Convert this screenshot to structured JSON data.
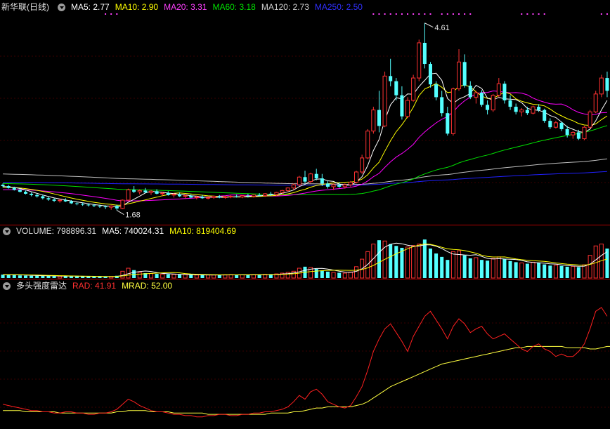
{
  "header": {
    "title": "新华联(日线)",
    "ma5": "MA5: 2.77",
    "ma10": "MA10: 2.90",
    "ma20": "MA20: 3.31",
    "ma60": "MA60: 3.18",
    "ma120": "MA120: 2.73",
    "ma250": "MA250: 2.50"
  },
  "volume_header": {
    "volume": "VOLUME: 798896.31",
    "ma5": "MA5: 740024.31",
    "ma10": "MA10: 819404.69"
  },
  "indicator_header": {
    "name": "多头强度雷达",
    "rad": "RAD: 41.91",
    "mrad": "MRAD: 52.00"
  },
  "annotations": {
    "high": "4.61",
    "low": "1.68"
  },
  "colors": {
    "up": "#ff3232",
    "down": "#54ffff",
    "ma5": "#ffffff",
    "ma10": "#ffff00",
    "ma20": "#ff00ff",
    "ma60": "#00e000",
    "ma120": "#c0c0c0",
    "ma250": "#2020ff",
    "rad": "#ff2020",
    "mrad": "#ffff40"
  },
  "chart_data": [
    {
      "type": "candlestick",
      "title": "新华联(日线)",
      "ylim": [
        1.5,
        4.75
      ],
      "ohlc": [
        [
          2.08,
          2.1,
          2.04,
          2.06
        ],
        [
          2.06,
          2.08,
          2.02,
          2.03
        ],
        [
          2.03,
          2.05,
          1.99,
          2.0
        ],
        [
          2.0,
          2.02,
          1.96,
          1.97
        ],
        [
          1.97,
          1.99,
          1.93,
          1.94
        ],
        [
          1.94,
          1.96,
          1.9,
          1.92
        ],
        [
          1.92,
          1.94,
          1.88,
          1.9
        ],
        [
          1.9,
          1.92,
          1.85,
          1.87
        ],
        [
          1.87,
          1.89,
          1.83,
          1.85
        ],
        [
          1.85,
          1.87,
          1.81,
          1.83
        ],
        [
          1.83,
          1.86,
          1.8,
          1.84
        ],
        [
          1.84,
          1.87,
          1.81,
          1.82
        ],
        [
          1.82,
          1.84,
          1.78,
          1.79
        ],
        [
          1.79,
          1.81,
          1.76,
          1.78
        ],
        [
          1.78,
          1.8,
          1.75,
          1.77
        ],
        [
          1.77,
          1.79,
          1.74,
          1.76
        ],
        [
          1.76,
          1.78,
          1.73,
          1.75
        ],
        [
          1.75,
          1.77,
          1.72,
          1.74
        ],
        [
          1.74,
          1.76,
          1.7,
          1.73
        ],
        [
          1.73,
          1.76,
          1.69,
          1.75
        ],
        [
          1.75,
          1.77,
          1.68,
          1.71
        ],
        [
          1.71,
          1.85,
          1.7,
          1.84
        ],
        [
          1.84,
          2.02,
          1.83,
          2.0
        ],
        [
          2.0,
          2.06,
          1.95,
          1.97
        ],
        [
          1.97,
          2.01,
          1.93,
          1.99
        ],
        [
          1.99,
          2.03,
          1.95,
          1.96
        ],
        [
          1.96,
          2.0,
          1.92,
          1.98
        ],
        [
          1.98,
          2.01,
          1.93,
          1.94
        ],
        [
          1.94,
          1.97,
          1.9,
          1.95
        ],
        [
          1.95,
          1.98,
          1.91,
          1.92
        ],
        [
          1.92,
          1.95,
          1.88,
          1.93
        ],
        [
          1.93,
          1.96,
          1.89,
          1.9
        ],
        [
          1.9,
          1.93,
          1.86,
          1.91
        ],
        [
          1.91,
          1.93,
          1.87,
          1.88
        ],
        [
          1.88,
          1.91,
          1.85,
          1.89
        ],
        [
          1.89,
          1.92,
          1.86,
          1.87
        ],
        [
          1.87,
          1.9,
          1.85,
          1.88
        ],
        [
          1.88,
          1.91,
          1.86,
          1.9
        ],
        [
          1.9,
          1.92,
          1.87,
          1.88
        ],
        [
          1.88,
          1.91,
          1.86,
          1.89
        ],
        [
          1.89,
          1.92,
          1.87,
          1.9
        ],
        [
          1.9,
          1.93,
          1.88,
          1.89
        ],
        [
          1.89,
          1.92,
          1.87,
          1.91
        ],
        [
          1.91,
          1.94,
          1.88,
          1.9
        ],
        [
          1.9,
          1.93,
          1.88,
          1.92
        ],
        [
          1.92,
          1.95,
          1.9,
          1.91
        ],
        [
          1.91,
          1.95,
          1.89,
          1.94
        ],
        [
          1.94,
          1.97,
          1.91,
          1.93
        ],
        [
          1.93,
          1.97,
          1.91,
          1.96
        ],
        [
          1.96,
          2.0,
          1.94,
          1.99
        ],
        [
          1.99,
          2.04,
          1.97,
          2.03
        ],
        [
          2.03,
          2.1,
          2.0,
          2.08
        ],
        [
          2.08,
          2.22,
          2.06,
          2.2
        ],
        [
          2.2,
          2.3,
          2.1,
          2.13
        ],
        [
          2.13,
          2.27,
          2.1,
          2.25
        ],
        [
          2.25,
          2.33,
          2.15,
          2.18
        ],
        [
          2.18,
          2.25,
          2.06,
          2.1
        ],
        [
          2.1,
          2.14,
          2.02,
          2.05
        ],
        [
          2.05,
          2.1,
          2.0,
          2.08
        ],
        [
          2.08,
          2.12,
          2.03,
          2.05
        ],
        [
          2.05,
          2.1,
          2.02,
          2.08
        ],
        [
          2.08,
          2.14,
          2.05,
          2.12
        ],
        [
          2.12,
          2.3,
          2.1,
          2.28
        ],
        [
          2.28,
          2.55,
          2.25,
          2.5
        ],
        [
          2.5,
          2.95,
          2.48,
          2.92
        ],
        [
          2.92,
          3.3,
          2.88,
          3.25
        ],
        [
          3.25,
          3.55,
          2.9,
          3.0
        ],
        [
          3.0,
          3.85,
          2.98,
          3.78
        ],
        [
          3.78,
          4.05,
          3.62,
          3.7
        ],
        [
          3.7,
          3.75,
          3.4,
          3.48
        ],
        [
          3.48,
          3.62,
          3.1,
          3.15
        ],
        [
          3.15,
          3.45,
          3.12,
          3.4
        ],
        [
          3.4,
          3.8,
          3.38,
          3.75
        ],
        [
          3.75,
          4.35,
          3.7,
          4.3
        ],
        [
          4.3,
          4.61,
          3.9,
          3.97
        ],
        [
          3.97,
          4.0,
          3.6,
          3.65
        ],
        [
          3.65,
          3.7,
          3.4,
          3.45
        ],
        [
          3.45,
          3.55,
          3.15,
          3.2
        ],
        [
          3.2,
          3.3,
          2.85,
          2.88
        ],
        [
          2.88,
          3.6,
          2.85,
          3.58
        ],
        [
          3.58,
          4.2,
          3.55,
          4.0
        ],
        [
          4.0,
          4.12,
          3.6,
          3.63
        ],
        [
          3.63,
          3.7,
          3.42,
          3.45
        ],
        [
          3.45,
          3.55,
          3.35,
          3.52
        ],
        [
          3.52,
          3.56,
          3.3,
          3.33
        ],
        [
          3.33,
          3.4,
          3.18,
          3.25
        ],
        [
          3.25,
          3.5,
          3.22,
          3.48
        ],
        [
          3.48,
          3.75,
          3.45,
          3.66
        ],
        [
          3.66,
          3.7,
          3.35,
          3.4
        ],
        [
          3.4,
          3.48,
          3.25,
          3.3
        ],
        [
          3.3,
          3.35,
          3.18,
          3.22
        ],
        [
          3.22,
          3.28,
          3.15,
          3.25
        ],
        [
          3.25,
          3.3,
          3.17,
          3.2
        ],
        [
          3.2,
          3.32,
          3.18,
          3.3
        ],
        [
          3.3,
          3.34,
          3.22,
          3.25
        ],
        [
          3.25,
          3.27,
          3.05,
          3.08
        ],
        [
          3.08,
          3.12,
          2.95,
          2.98
        ],
        [
          2.98,
          3.08,
          2.96,
          3.05
        ],
        [
          3.05,
          3.07,
          2.92,
          2.95
        ],
        [
          2.95,
          3.0,
          2.82,
          2.86
        ],
        [
          2.86,
          2.92,
          2.8,
          2.9
        ],
        [
          2.9,
          2.94,
          2.78,
          2.8
        ],
        [
          2.8,
          3.0,
          2.78,
          2.98
        ],
        [
          2.98,
          3.25,
          2.96,
          3.22
        ],
        [
          3.22,
          3.55,
          3.2,
          3.5
        ],
        [
          3.5,
          3.8,
          3.45,
          3.75
        ],
        [
          3.75,
          3.85,
          3.45,
          3.55
        ]
      ],
      "ma_periods": [
        5,
        10,
        20,
        60,
        120,
        250
      ],
      "ma_values_last": [
        2.77,
        2.9,
        3.31,
        3.18,
        2.73,
        2.5
      ],
      "annotations": [
        {
          "label": "4.61",
          "type": "high"
        },
        {
          "label": "1.68",
          "type": "low"
        }
      ]
    },
    {
      "type": "bar",
      "title": "VOLUME",
      "series": [
        {
          "name": "VOLUME",
          "values": [
            90,
            85,
            80,
            70,
            65,
            60,
            62,
            58,
            55,
            50,
            48,
            52,
            45,
            42,
            40,
            38,
            36,
            35,
            38,
            42,
            60,
            180,
            260,
            210,
            150,
            130,
            120,
            110,
            105,
            100,
            95,
            90,
            88,
            85,
            80,
            78,
            82,
            80,
            85,
            88,
            90,
            86,
            84,
            88,
            92,
            95,
            98,
            100,
            110,
            130,
            150,
            180,
            260,
            300,
            280,
            240,
            200,
            170,
            150,
            140,
            130,
            160,
            300,
            500,
            700,
            900,
            1000,
            980,
            900,
            850,
            800,
            820,
            860,
            900,
            1020,
            780,
            650,
            560,
            480,
            700,
            720,
            600,
            520,
            540,
            480,
            460,
            520,
            560,
            500,
            450,
            420,
            400,
            380,
            420,
            400,
            360,
            330,
            340,
            320,
            300,
            310,
            290,
            350,
            600,
            850,
            900,
            780
          ]
        },
        {
          "name": "MA5",
          "last": "740024.31"
        },
        {
          "name": "MA10",
          "last": "819404.69"
        }
      ]
    },
    {
      "type": "line",
      "title": "多头强度雷达",
      "series": [
        {
          "name": "RAD",
          "values": [
            18,
            17,
            16,
            15,
            14,
            13,
            13,
            12,
            12,
            11,
            11,
            12,
            12,
            11,
            11,
            10,
            10,
            11,
            11,
            12,
            14,
            18,
            22,
            20,
            17,
            15,
            13,
            12,
            12,
            11,
            10,
            10,
            9,
            9,
            8,
            8,
            9,
            9,
            10,
            10,
            9,
            9,
            10,
            10,
            11,
            11,
            12,
            12,
            13,
            14,
            16,
            20,
            25,
            22,
            28,
            30,
            26,
            20,
            18,
            16,
            15,
            17,
            24,
            32,
            45,
            60,
            70,
            78,
            82,
            75,
            68,
            60,
            72,
            80,
            88,
            92,
            85,
            78,
            70,
            80,
            86,
            82,
            75,
            78,
            80,
            74,
            70,
            72,
            74,
            70,
            66,
            62,
            60,
            64,
            66,
            62,
            60,
            56,
            58,
            56,
            56,
            60,
            66,
            78,
            92,
            95,
            88
          ]
        },
        {
          "name": "MRAD",
          "values": [
            13,
            13,
            13,
            13,
            12,
            12,
            12,
            12,
            12,
            12,
            11,
            11,
            11,
            11,
            11,
            11,
            11,
            11,
            11,
            11,
            12,
            12,
            13,
            13,
            13,
            13,
            12,
            12,
            12,
            12,
            11,
            11,
            11,
            11,
            11,
            11,
            10,
            10,
            10,
            10,
            10,
            10,
            10,
            10,
            10,
            10,
            10,
            11,
            11,
            11,
            11,
            12,
            12,
            13,
            14,
            15,
            15,
            16,
            16,
            16,
            16,
            16,
            17,
            18,
            20,
            23,
            26,
            29,
            32,
            34,
            36,
            38,
            40,
            42,
            44,
            46,
            48,
            50,
            51,
            52,
            53,
            54,
            55,
            56,
            57,
            58,
            59,
            60,
            61,
            62,
            63,
            63,
            64,
            64,
            64,
            64,
            64,
            64,
            64,
            63,
            63,
            63,
            63,
            62,
            62,
            63,
            64,
            64
          ]
        }
      ],
      "ylim": [
        0,
        105
      ]
    }
  ]
}
